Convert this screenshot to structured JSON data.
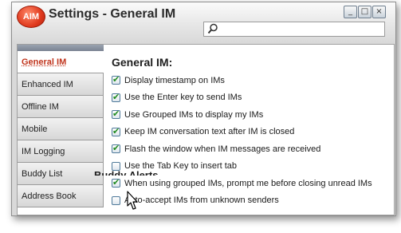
{
  "window": {
    "logo_text": "AIM",
    "title": "Settings - General IM",
    "controls": [
      "_",
      "□",
      "×"
    ]
  },
  "search": {
    "value": "",
    "placeholder": ""
  },
  "sidebar": {
    "items": [
      {
        "label": "General IM",
        "active": true
      },
      {
        "label": "Enhanced IM",
        "active": false
      },
      {
        "label": "Offline IM",
        "active": false
      },
      {
        "label": "Mobile",
        "active": false
      },
      {
        "label": "IM Logging",
        "active": false
      },
      {
        "label": "Buddy List",
        "active": false
      },
      {
        "label": "Address Book",
        "active": false
      }
    ]
  },
  "main": {
    "section_title": "General IM:",
    "options": [
      {
        "label": "Display timestamp on IMs",
        "checked": true
      },
      {
        "label": "Use the Enter key to send IMs",
        "checked": true
      },
      {
        "label": "Use Grouped IMs to display my IMs",
        "checked": true
      },
      {
        "label": "Keep IM conversation text after IM is closed",
        "checked": true
      },
      {
        "label": "Flash the window when IM messages are received",
        "checked": true
      },
      {
        "label": "Use the Tab Key to insert tab",
        "checked": false
      },
      {
        "label": "When using grouped IMs, prompt me before closing unread IMs",
        "checked": true
      },
      {
        "label": "Auto-accept IMs from unknown senders",
        "checked": false
      }
    ],
    "partial_heading": "Buddy Alerts"
  },
  "colors": {
    "active_tab_text": "#c0331b",
    "check": "#1f8a1f"
  }
}
